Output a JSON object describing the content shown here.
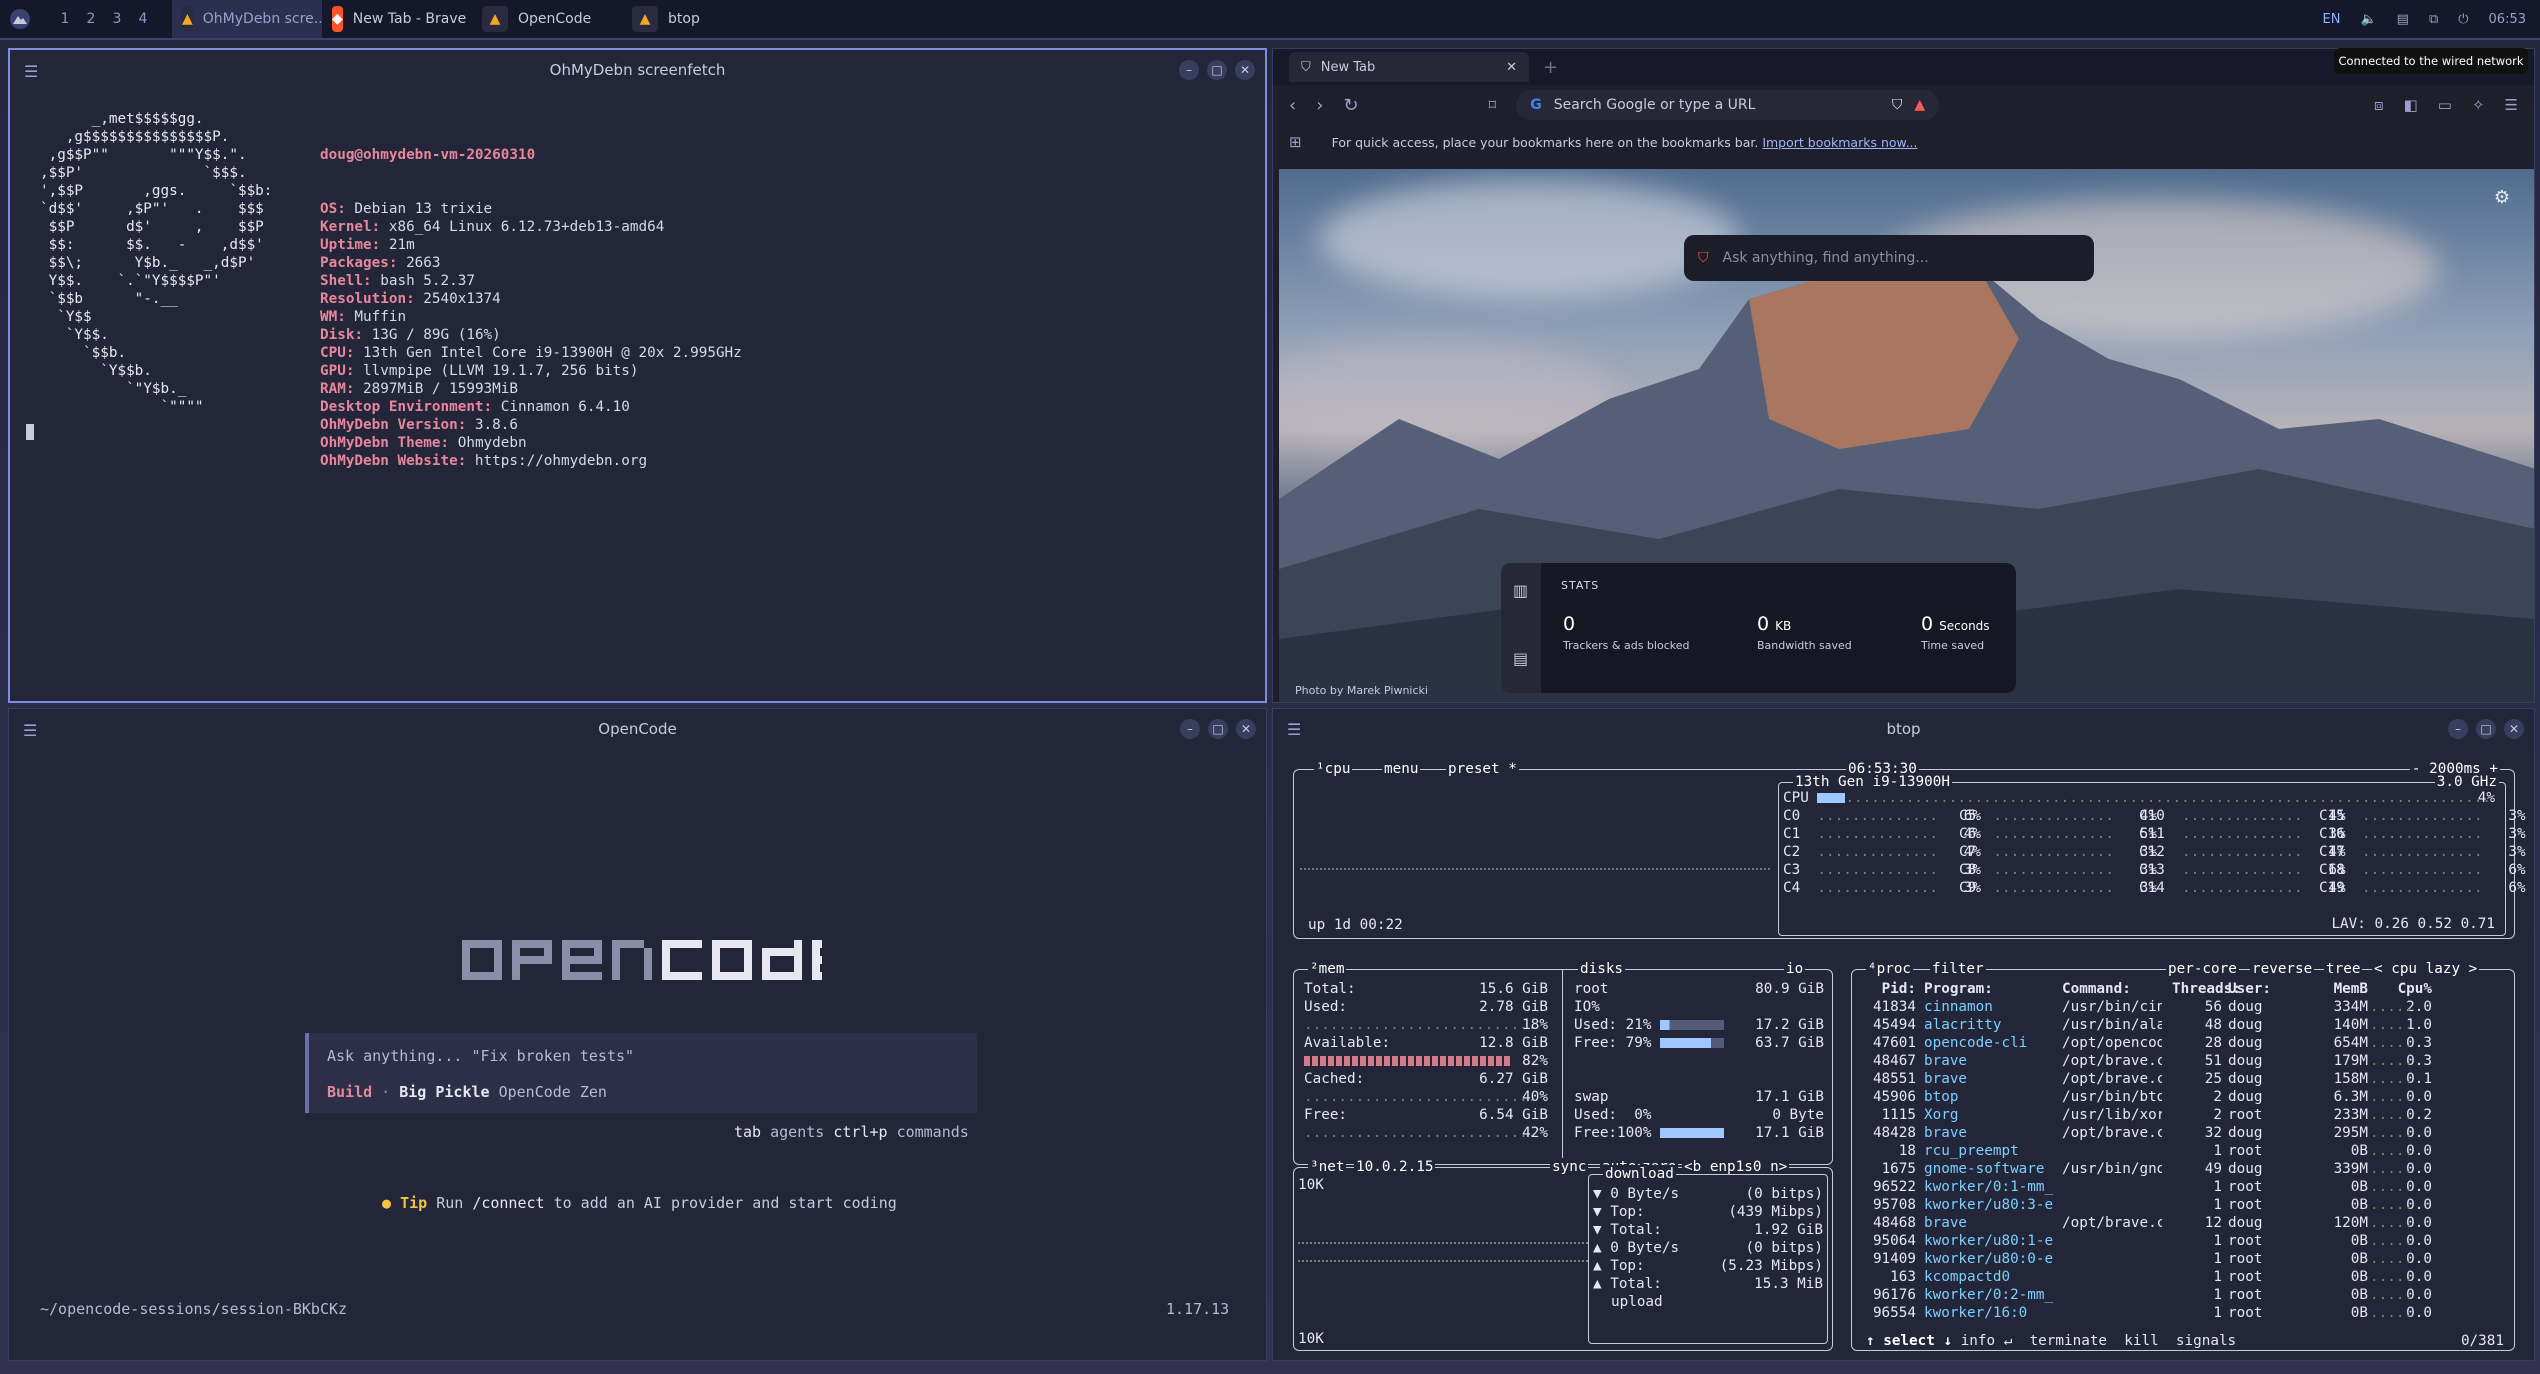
{
  "panel": {
    "workspaces": [
      "1",
      "2",
      "3",
      "4"
    ],
    "tasks": [
      {
        "label": "OhMyDebn scre...",
        "icon": "alacritty-icon",
        "active": true
      },
      {
        "label": "New Tab - Brave",
        "icon": "brave-icon",
        "active": false
      },
      {
        "label": "OpenCode",
        "icon": "alacritty-icon",
        "active": false
      },
      {
        "label": "btop",
        "icon": "alacritty-icon",
        "active": false
      }
    ],
    "lang": "EN",
    "clock": "06:53",
    "tooltip": "Connected to the wired network"
  },
  "screenfetch": {
    "title": "OhMyDebn screenfetch",
    "ascii": "      _,met$$$$$gg.\n   ,g$$$$$$$$$$$$$$$P.\n ,g$$P\"\"       \"\"\"Y$$.\".\n,$$P'              `$$$.\n',$$P       ,ggs.     `$$b:\n`d$$'     ,$P\"'   .    $$$\n $$P      d$'     ,    $$P\n $$:      $$.   -    ,d$$'\n $$\\;      Y$b._   _,d$P'\n Y$$.    `.`\"Y$$$$P\"'\n `$$b      \"-.__\n  `Y$$\n   `Y$$.\n     `$$b.\n       `Y$$b.\n          `\"Y$b._\n              `\"\"\"\"",
    "user": "doug@ohmydebn-vm-20260310",
    "info": [
      {
        "k": "OS:",
        "v": " Debian 13 trixie"
      },
      {
        "k": "Kernel:",
        "v": " x86_64 Linux 6.12.73+deb13-amd64"
      },
      {
        "k": "Uptime:",
        "v": " 21m"
      },
      {
        "k": "Packages:",
        "v": " 2663"
      },
      {
        "k": "Shell:",
        "v": " bash 5.2.37"
      },
      {
        "k": "Resolution:",
        "v": " 2540x1374"
      },
      {
        "k": "WM:",
        "v": " Muffin"
      },
      {
        "k": "Disk:",
        "v": " 13G / 89G (16%)"
      },
      {
        "k": "CPU:",
        "v": " 13th Gen Intel Core i9-13900H @ 20x 2.995GHz"
      },
      {
        "k": "GPU:",
        "v": " llvmpipe (LLVM 19.1.7, 256 bits)"
      },
      {
        "k": "RAM:",
        "v": " 2897MiB / 15993MiB"
      },
      {
        "k": "Desktop Environment:",
        "v": " Cinnamon 6.4.10"
      },
      {
        "k": "OhMyDebn Version:",
        "v": " 3.8.6"
      },
      {
        "k": "OhMyDebn Theme:",
        "v": " Ohmydebn"
      },
      {
        "k": "OhMyDebn Website:",
        "v": " https://ohmydebn.org"
      }
    ]
  },
  "brave": {
    "tab": "New Tab",
    "url_placeholder": "Search Google or type a URL",
    "bm_text": "For quick access, place your bookmarks here on the bookmarks bar.",
    "bm_link": "Import bookmarks now...",
    "search_placeholder": "Ask anything, find anything...",
    "stats_title": "STATS",
    "stats": [
      {
        "value": "0",
        "unit": "",
        "label": "Trackers & ads blocked"
      },
      {
        "value": "0",
        "unit": "KB",
        "label": "Bandwidth saved"
      },
      {
        "value": "0",
        "unit": "Seconds",
        "label": "Time saved"
      }
    ],
    "photo": "Photo by Marek Piwnicki"
  },
  "opencode": {
    "title": "OpenCode",
    "logo_a": "open",
    "logo_b": "code",
    "placeholder": "Ask anything... \"Fix broken tests\"",
    "mode": "Build",
    "model": "Big Pickle",
    "provider": "OpenCode Zen",
    "hint1_key": "tab",
    "hint1": "agents",
    "hint2_key": "ctrl+p",
    "hint2": "commands",
    "tip_label": "Tip",
    "tip_pre": "Run ",
    "tip_cmd": "/connect",
    "tip_post": " to add an AI provider and start coding",
    "path": "~/opencode-sessions/session-BKbCKz",
    "version": "1.17.13"
  },
  "btop": {
    "title": "btop",
    "cpu_box_labels": [
      "¹cpu",
      "menu",
      "preset *"
    ],
    "time": "06:53:30",
    "interval": "- 2000ms +",
    "cpu_name": "13th Gen i9-13900H",
    "freq": "3.0 GHz",
    "uptime": "up 1d 00:22",
    "cpu_total": "4%",
    "cores": [
      [
        "C0",
        "6%",
        "C5",
        "4%",
        "C10",
        "4%",
        "C15",
        "3%"
      ],
      [
        "C1",
        "4%",
        "C6",
        "5%",
        "C11",
        "3%",
        "C16",
        "3%"
      ],
      [
        "C2",
        "4%",
        "C7",
        "3%",
        "C12",
        "4%",
        "C17",
        "3%"
      ],
      [
        "C3",
        "3%",
        "C8",
        "3%",
        "C13",
        "6%",
        "C18",
        "6%"
      ],
      [
        "C4",
        "3%",
        "C9",
        "3%",
        "C14",
        "4%",
        "C19",
        "6%"
      ]
    ],
    "lav": "LAV: 0.26 0.52 0.71",
    "mem": {
      "label": "²mem",
      "total": "15.6 GiB",
      "used": "2.78 GiB",
      "used_pct": "18%",
      "avail": "12.8 GiB",
      "avail_pct": "82%",
      "cached": "6.27 GiB",
      "cached_pct": "40%",
      "free": "6.54 GiB",
      "free_pct": "42%"
    },
    "disks": {
      "label": "disks",
      "io": "io",
      "root_size": "80.9 GiB",
      "io_pct": "IO%",
      "used_pct": "21%",
      "used": "17.2 GiB",
      "free_pct": "79%",
      "free": "63.7 GiB",
      "swap_size": "17.1 GiB",
      "swap_used_pct": "0%",
      "swap_used": "0 Byte",
      "swap_free_pct": "100%",
      "swap_free": "17.1 GiB"
    },
    "net": {
      "label": "³net",
      "ip": "10.0.2.15",
      "sync": "sync",
      "auto": "auto",
      "zero": "zero",
      "iface": "<b enp1s0 n>",
      "scale_top": "10K",
      "scale_bot": "10K",
      "dl_rate": "0 Byte/s",
      "dl_bits": "(0 bitps)",
      "dl_top": "(439 Mibps)",
      "dl_total": "1.92 GiB",
      "ul_rate": "0 Byte/s",
      "ul_bits": "(0 bitps)",
      "ul_top": "(5.23 Mibps)",
      "ul_total": "15.3 MiB"
    },
    "proc_header": [
      "⁴proc",
      "filter",
      "per-core",
      "reverse",
      "tree",
      "< cpu lazy >"
    ],
    "proc_cols": [
      "Pid:",
      "Program:",
      "Command:",
      "Threads:",
      "User:",
      "MemB",
      "Cpu%"
    ],
    "procs": [
      [
        "41834",
        "cinnamon",
        "/usr/bin/cin",
        "56",
        "doug",
        "334M",
        "2.0"
      ],
      [
        "45494",
        "alacritty",
        "/usr/bin/ala",
        "48",
        "doug",
        "140M",
        "1.0"
      ],
      [
        "47601",
        "opencode-cli",
        "/opt/opencod",
        "28",
        "doug",
        "654M",
        "0.3"
      ],
      [
        "48467",
        "brave",
        "/opt/brave.c",
        "51",
        "doug",
        "179M",
        "0.3"
      ],
      [
        "48551",
        "brave",
        "/opt/brave.c",
        "25",
        "doug",
        "158M",
        "0.1"
      ],
      [
        "45906",
        "btop",
        "/usr/bin/bto",
        "2",
        "doug",
        "6.3M",
        "0.0"
      ],
      [
        "1115",
        "Xorg",
        "/usr/lib/xor",
        "2",
        "root",
        "233M",
        "0.2"
      ],
      [
        "48428",
        "brave",
        "/opt/brave.c",
        "32",
        "doug",
        "295M",
        "0.0"
      ],
      [
        "18",
        "rcu_preempt",
        "",
        "1",
        "root",
        "0B",
        "0.0"
      ],
      [
        "1675",
        "gnome-software",
        "/usr/bin/gno",
        "49",
        "doug",
        "339M",
        "0.0"
      ],
      [
        "96522",
        "kworker/0:1-mm_p",
        "",
        "1",
        "root",
        "0B",
        "0.0"
      ],
      [
        "95708",
        "kworker/u80:3-ev",
        "",
        "1",
        "root",
        "0B",
        "0.0"
      ],
      [
        "48468",
        "brave",
        "/opt/brave.c",
        "12",
        "doug",
        "120M",
        "0.0"
      ],
      [
        "95064",
        "kworker/u80:1-ev",
        "",
        "1",
        "root",
        "0B",
        "0.0"
      ],
      [
        "91409",
        "kworker/u80:0-ev",
        "",
        "1",
        "root",
        "0B",
        "0.0"
      ],
      [
        "163",
        "kcompactd0",
        "",
        "1",
        "root",
        "0B",
        "0.0"
      ],
      [
        "96176",
        "kworker/0:2-mm_p",
        "",
        "1",
        "root",
        "0B",
        "0.0"
      ],
      [
        "96554",
        "kworker/16:0",
        "",
        "1",
        "root",
        "0B",
        "0.0"
      ]
    ],
    "proc_footer": [
      "↑ select ↓",
      "info ↵",
      "terminate",
      "kill",
      "signals"
    ],
    "proc_count": "0/381"
  },
  "colors": {
    "accent": "#7f8cdf",
    "pink": "#e8879b",
    "cyan": "#7ad0ff"
  }
}
